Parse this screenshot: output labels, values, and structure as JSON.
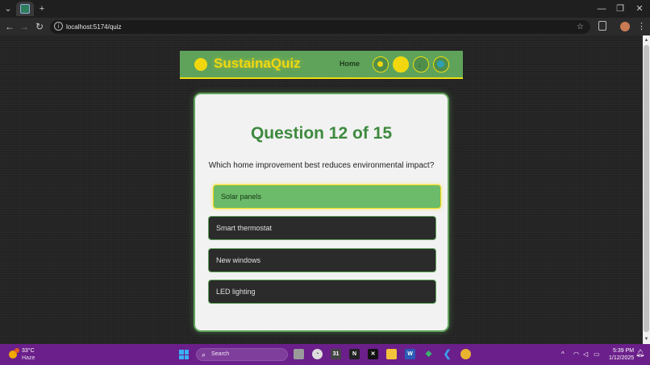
{
  "browser": {
    "url": "localhost:5174/quiz",
    "window_controls": {
      "minimize": "—",
      "restore": "❐",
      "close": "✕"
    }
  },
  "app": {
    "logo_text": "SustainaQuiz",
    "nav_home": "Home"
  },
  "quiz": {
    "title": "Question 12 of 15",
    "question": "Which home improvement best reduces environmental impact?",
    "options": [
      {
        "label": "Solar panels",
        "selected": true
      },
      {
        "label": "Smart thermostat",
        "selected": false
      },
      {
        "label": "New windows",
        "selected": false
      },
      {
        "label": "LED lighting",
        "selected": false
      }
    ]
  },
  "taskbar": {
    "weather_temp": "33°C",
    "weather_condition": "Haze",
    "search_placeholder": "Search",
    "time": "5:39 PM",
    "date": "1/12/2025"
  },
  "colors": {
    "accent_green": "#5fa35a",
    "accent_yellow": "#f2d70e",
    "title_green": "#3d8a3e",
    "taskbar_purple": "#6b1f8a"
  }
}
